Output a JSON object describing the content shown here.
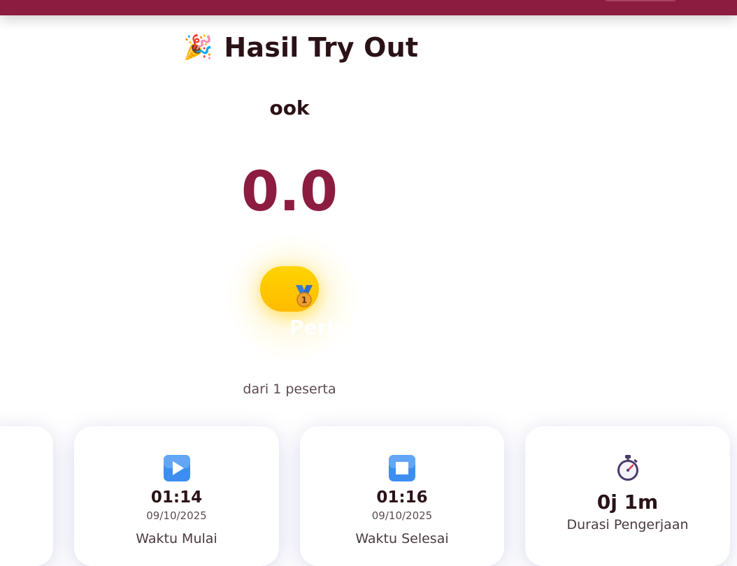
{
  "header": {
    "title": "Hasil Try Out",
    "title_icon": "party-popper-icon"
  },
  "result": {
    "user_name": "ook",
    "score": "0.0",
    "rank_text": "Peringkat 1",
    "rank_icon": "medal-1-icon",
    "participants_text": "dari 1 peserta"
  },
  "stats": [
    {
      "icon": "play-icon",
      "value": "01:14",
      "date": "09/10/2025",
      "label": "Waktu Mulai"
    },
    {
      "icon": "stop-icon",
      "value": "01:16",
      "date": "09/10/2025",
      "label": "Waktu Selesai"
    },
    {
      "icon": "stopwatch-icon",
      "value": "0j 1m",
      "label": "Durasi Pengerjaan"
    }
  ],
  "colors": {
    "brand": "#8c1d40",
    "rank_badge": "#ffc800",
    "text": "#2b1216"
  }
}
